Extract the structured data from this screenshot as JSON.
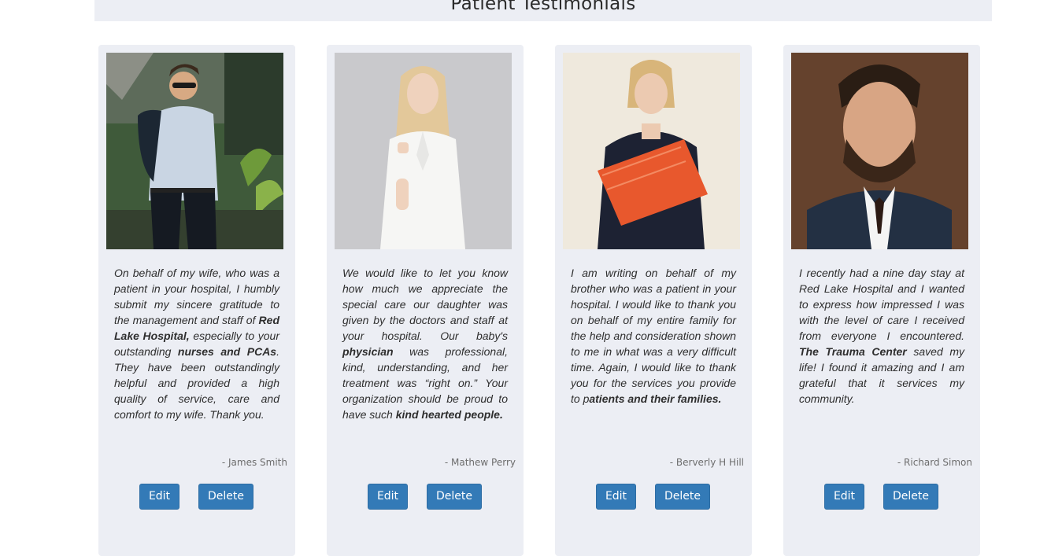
{
  "section": {
    "title": "Patient Testimonials"
  },
  "testimonials": [
    {
      "photo_alt": "man in blue shirt and sunglasses",
      "quote_parts": [
        {
          "text": "On behalf of my wife, who was a patient in your hospital, I humbly submit my sincere gratitude to the management and staff of ",
          "bold": false
        },
        {
          "text": "Red Lake Hospital,",
          "bold": true
        },
        {
          "text": " especially to your outstanding ",
          "bold": false
        },
        {
          "text": "nurses and PCAs",
          "bold": true
        },
        {
          "text": ". They have been outstandingly helpful and provided a high quality of service, care and comfort to my wife. Thank you.",
          "bold": false
        }
      ],
      "author": "- James Smith",
      "edit_label": "Edit",
      "delete_label": "Delete"
    },
    {
      "photo_alt": "blonde woman in white shirt",
      "quote_parts": [
        {
          "text": "We would like to let you know how much we appreciate the special care our daughter was given by the doctors and staff at your hospital. Our baby's ",
          "bold": false
        },
        {
          "text": "physician",
          "bold": true
        },
        {
          "text": " was professional, kind, understanding, and her treatment was “right on.” Your organization should be proud to have such ",
          "bold": false
        },
        {
          "text": "kind hearted people.",
          "bold": true
        }
      ],
      "author": "- Mathew Perry",
      "edit_label": "Edit",
      "delete_label": "Delete"
    },
    {
      "photo_alt": "smiling woman holding orange folder",
      "quote_parts": [
        {
          "text": "I am writing on behalf of my brother who was a patient in your hospital. I would like to thank you on behalf of my entire family for the help and consideration shown to me in what was a very difficult time. Again, I would like to thank you for the services you provide to p",
          "bold": false
        },
        {
          "text": "atients and their families.",
          "bold": true
        }
      ],
      "author": "- Berverly H Hill",
      "edit_label": "Edit",
      "delete_label": "Delete"
    },
    {
      "photo_alt": "bearded man in suit",
      "quote_parts": [
        {
          "text": "I recently had a nine day stay at Red Lake Hospital and I wanted to express how impressed I was with the level of care I received from everyone I encountered. ",
          "bold": false
        },
        {
          "text": "The Trauma Center",
          "bold": true
        },
        {
          "text": " saved my life! I found it amazing and I am grateful that it services my community.",
          "bold": false
        }
      ],
      "author": "- Richard Simon",
      "edit_label": "Edit",
      "delete_label": "Delete"
    }
  ]
}
